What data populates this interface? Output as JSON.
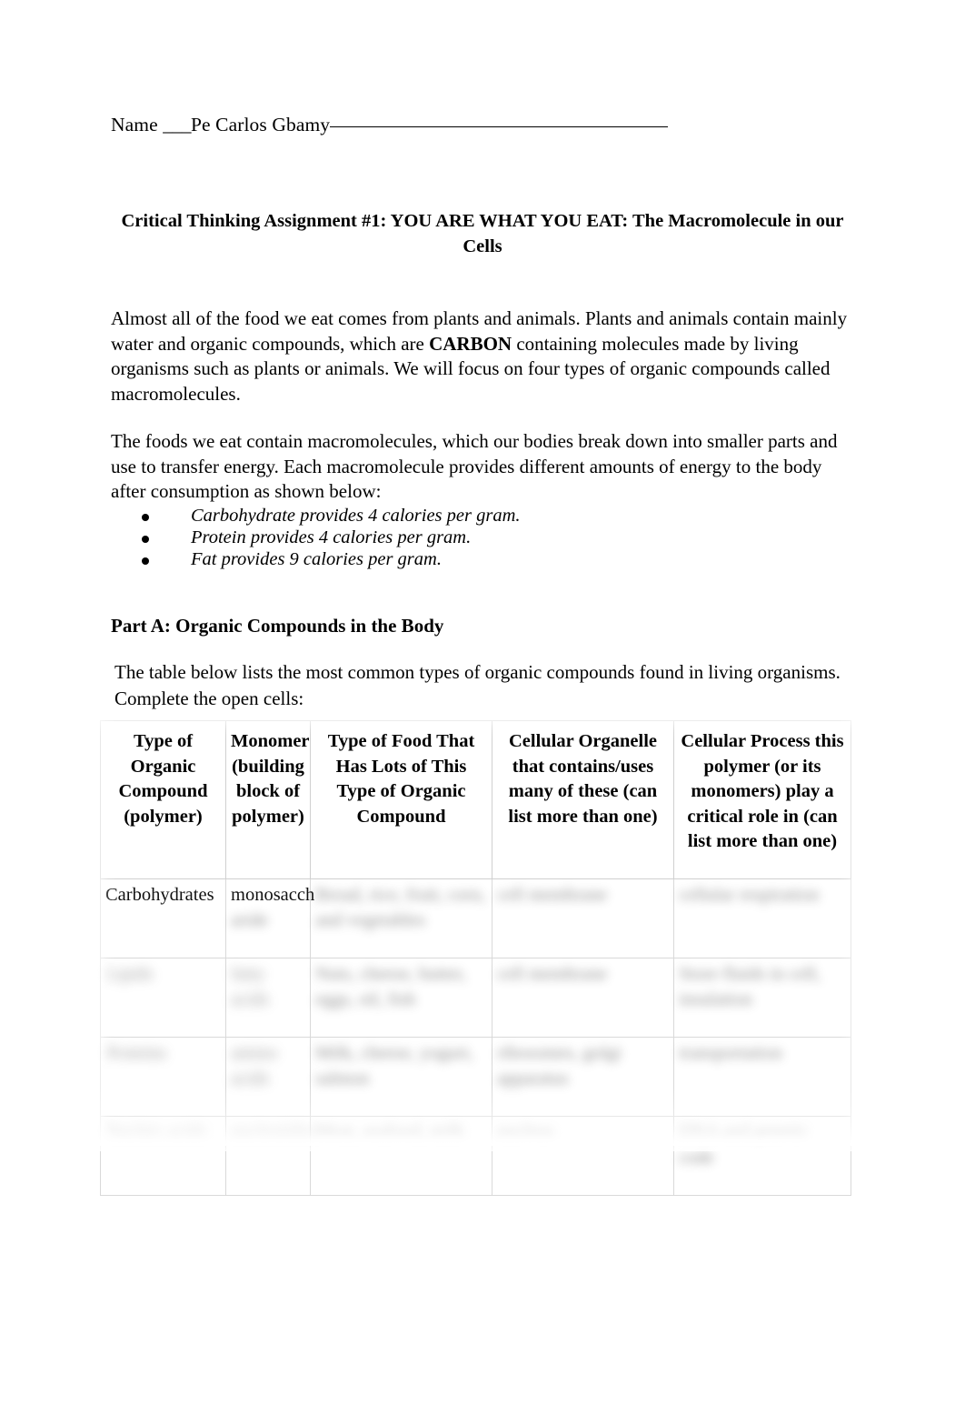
{
  "name_line": {
    "label": "Name ",
    "blank_prefix": "___",
    "value": "Pe Carlos Gbamy"
  },
  "title": "Critical Thinking Assignment #1:  YOU ARE WHAT YOU EAT: The Macromolecule in our Cells",
  "paragraphs": {
    "p1_a": "Almost all of the food we eat comes from plants and animals.  Plants and animals contain mainly water and organic compounds, which are ",
    "p1_bold": "CARBON",
    "p1_b": " containing molecules made by living organisms such as plants or animals.  We will focus on four types of organic compounds called macromolecules.",
    "p2": "The foods we eat contain macromolecules, which our bodies break down into smaller parts and use to transfer energy.   Each macromolecule provides different amounts of energy to the body after consumption as shown below:"
  },
  "bullets": [
    "Carbohydrate provides 4 calories per gram.",
    "Protein provides 4 calories per gram.",
    "Fat provides 9 calories per gram."
  ],
  "part_a": {
    "heading": "Part A: Organic Compounds in the Body",
    "instructions": "The table below lists the most common types of organic compounds found in living organisms. Complete the open cells:"
  },
  "table": {
    "headers": [
      "Type of Organic Compound (polymer)",
      "Monomer (building block of polymer)",
      "Type of Food That Has Lots of This Type of Organic Compound",
      "Cellular Organelle that contains/uses many of these (can list more than one)",
      "Cellular Process this polymer (or its monomers) play a critical role in (can list more than one)"
    ],
    "rows": [
      {
        "cells": [
          {
            "text": "Carbohydrates",
            "state": "clear"
          },
          {
            "text": "monosaccharide",
            "state": "partial"
          },
          {
            "text": "Bread, rice, fruit, corn, and vegetables",
            "state": "blurred"
          },
          {
            "text": "cell membrane",
            "state": "blurred"
          },
          {
            "text": "cellular respiration",
            "state": "blurred"
          }
        ]
      },
      {
        "cells": [
          {
            "text": "Lipids",
            "state": "blurred"
          },
          {
            "text": "fatty acids",
            "state": "blurred"
          },
          {
            "text": "Nuts, cheese, butter, eggs, oil, fish",
            "state": "blurred"
          },
          {
            "text": "cell membrane",
            "state": "blurred"
          },
          {
            "text": "Store fluids in cell, insulation",
            "state": "blurred"
          }
        ]
      },
      {
        "cells": [
          {
            "text": "Proteins",
            "state": "blurred"
          },
          {
            "text": "amino acids",
            "state": "blurred"
          },
          {
            "text": "Milk, cheese, yogurt, salmon",
            "state": "blurred"
          },
          {
            "text": "ribosomes, golgi apparatus",
            "state": "blurred"
          },
          {
            "text": "transportation",
            "state": "blurred"
          }
        ]
      },
      {
        "cells": [
          {
            "text": "Nucleic acids",
            "state": "blurred"
          },
          {
            "text": "nucleotides",
            "state": "blurred"
          },
          {
            "text": "Meat, seafood, milk",
            "state": "blurred"
          },
          {
            "text": "nucleus",
            "state": "blurred"
          },
          {
            "text": "DNA and genetic code",
            "state": "blurred"
          }
        ]
      }
    ]
  }
}
